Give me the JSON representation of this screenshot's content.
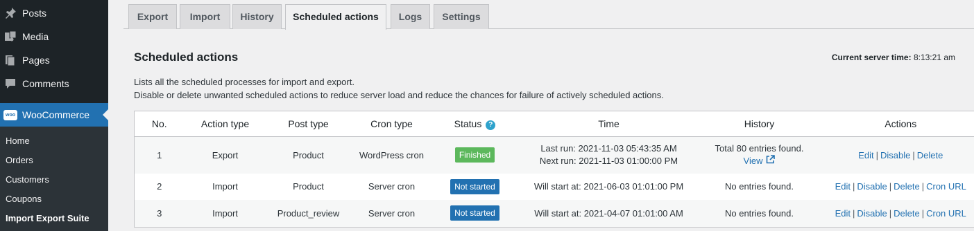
{
  "sidebar": {
    "items": [
      {
        "label": "Posts",
        "icon": "pin-icon"
      },
      {
        "label": "Media",
        "icon": "media-icon"
      },
      {
        "label": "Pages",
        "icon": "pages-icon"
      },
      {
        "label": "Comments",
        "icon": "comment-icon"
      },
      {
        "label": "WooCommerce",
        "icon": "woocommerce-icon",
        "icon_text": "woo"
      }
    ],
    "submenu": [
      "Home",
      "Orders",
      "Customers",
      "Coupons",
      "Import Export Suite"
    ]
  },
  "tabs": [
    "Export",
    "Import",
    "History",
    "Scheduled actions",
    "Logs",
    "Settings"
  ],
  "page": {
    "title": "Scheduled actions",
    "server_time_label": "Current server time:",
    "server_time_value": "8:13:21 am",
    "description_1": "Lists all the scheduled processes for import and export.",
    "description_2": "Disable or delete unwanted scheduled actions to reduce server load and reduce the chances for failure of actively scheduled actions."
  },
  "table": {
    "headers": [
      "No.",
      "Action type",
      "Post type",
      "Cron type",
      "Status",
      "Time",
      "History",
      "Actions"
    ],
    "help_glyph": "?",
    "rows": [
      {
        "no": "1",
        "action_type": "Export",
        "post_type": "Product",
        "cron_type": "WordPress cron",
        "status": "Finished",
        "time_1": "Last run: 2021-11-03 05:43:35 AM",
        "time_2": "Next run: 2021-11-03 01:00:00 PM",
        "history_1": "Total 80 entries found.",
        "history_link": "View",
        "actions": [
          "Edit",
          "Disable",
          "Delete"
        ]
      },
      {
        "no": "2",
        "action_type": "Import",
        "post_type": "Product",
        "cron_type": "Server cron",
        "status": "Not started",
        "time_1": "Will start at: 2021-06-03 01:01:00 PM",
        "history_1": "No entries found.",
        "actions": [
          "Edit",
          "Disable",
          "Delete",
          "Cron URL"
        ]
      },
      {
        "no": "3",
        "action_type": "Import",
        "post_type": "Product_review",
        "cron_type": "Server cron",
        "status": "Not started",
        "time_1": "Will start at: 2021-04-07 01:01:00 AM",
        "history_1": "No entries found.",
        "actions": [
          "Edit",
          "Disable",
          "Delete",
          "Cron URL"
        ]
      }
    ],
    "separator": "|"
  },
  "colors": {
    "sidebar_bg": "#1d2327",
    "active_menu": "#2271b1",
    "finished": "#5cb85c",
    "not_started": "#2271b1",
    "link": "#2271b1"
  }
}
